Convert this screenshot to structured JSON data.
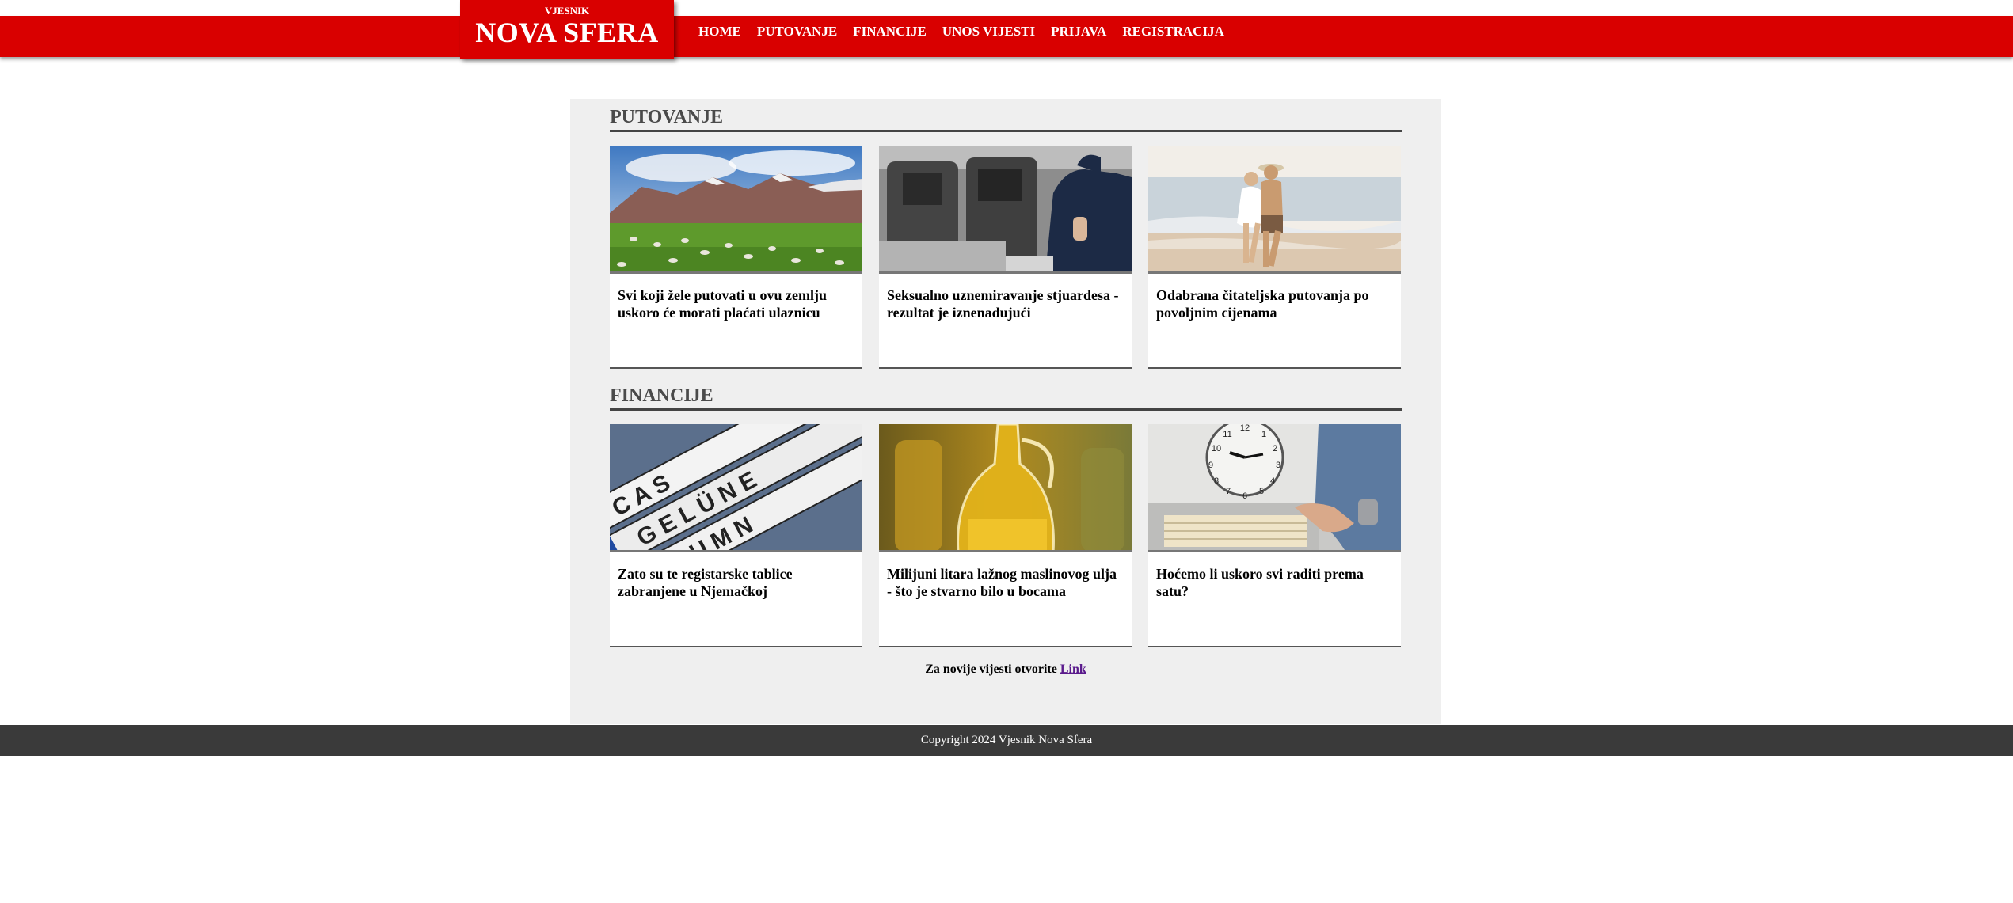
{
  "header": {
    "kicker": "VJESNIK",
    "brand": "NOVA SFERA",
    "nav": [
      "HOME",
      "PUTOVANJE",
      "FINANCIJE",
      "UNOS VIJESTI",
      "PRIJAVA",
      "REGISTRACIJA"
    ]
  },
  "sections": [
    {
      "title": "PUTOVANJE",
      "articles": [
        {
          "title": "Svi koji žele putovati u ovu zemlju uskoro će morati plaćati ulaznicu",
          "image_icon": "mountain-meadow-sheep-image"
        },
        {
          "title": "Seksualno uznemiravanje stjuardesa - rezultat je iznenađujući",
          "image_icon": "airplane-cabin-image"
        },
        {
          "title": "Odabrana čitateljska putovanja po povoljnim cijenama",
          "image_icon": "beach-couple-image"
        }
      ]
    },
    {
      "title": "FINANCIJE",
      "articles": [
        {
          "title": "Zato su te registarske tablice zabranjene u Njemačkoj",
          "image_icon": "license-plates-image"
        },
        {
          "title": "Milijuni litara lažnog maslinovog ulja - što je stvarno bilo u bocama",
          "image_icon": "olive-oil-bottle-image"
        },
        {
          "title": "Hoćemo li uskoro svi raditi prema satu?",
          "image_icon": "time-clock-image"
        }
      ]
    }
  ],
  "more": {
    "text": "Za novije vijesti otvorite ",
    "link": "Link"
  },
  "footer": {
    "text": "Copyright 2024 Vjesnik Nova Sfera"
  },
  "colors": {
    "accent": "#d90000",
    "panel": "#efefef",
    "footer": "#3a3a3a"
  }
}
